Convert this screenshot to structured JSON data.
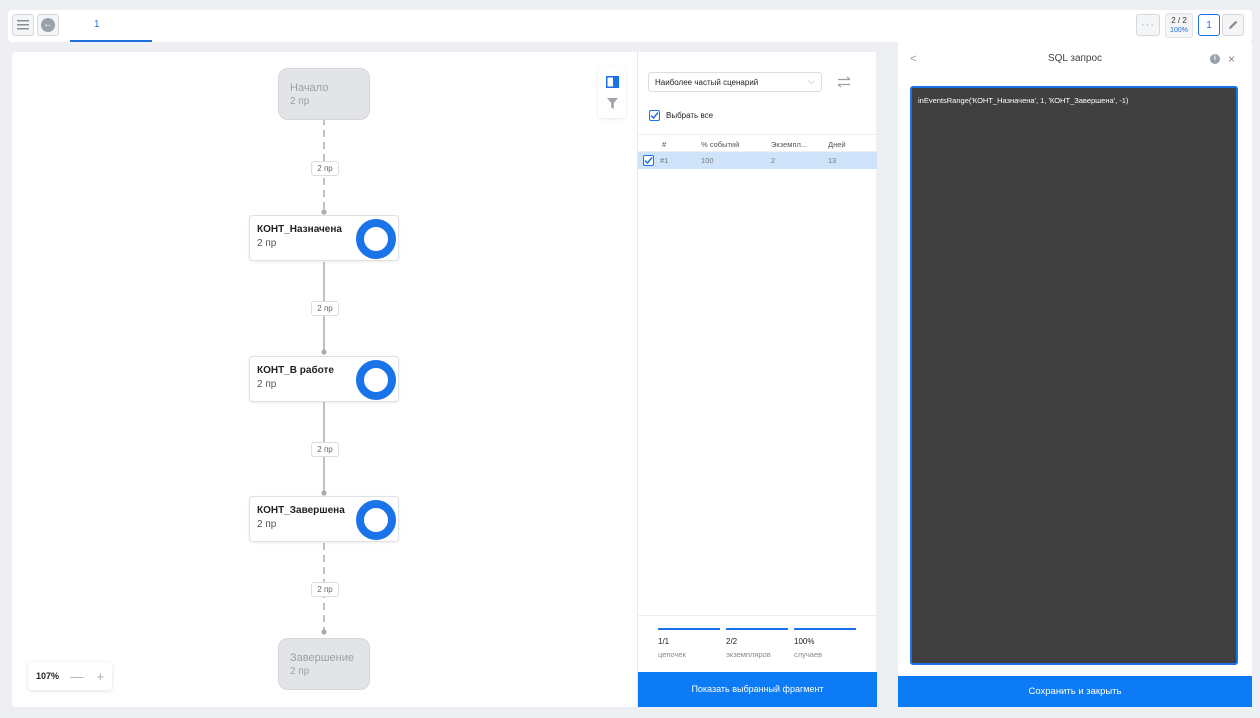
{
  "topbar": {
    "tab_label": "1",
    "more_label": "···",
    "count": "2 / 2",
    "count_pct": "100%",
    "page_number": "1"
  },
  "flow": {
    "start": {
      "title": "Начало",
      "count": "2 пр"
    },
    "end": {
      "title": "Завершение",
      "count": "2 пр"
    },
    "nodes": [
      {
        "title": "КОНТ_Назначена",
        "count": "2 пр"
      },
      {
        "title": "КОНТ_В работе",
        "count": "2 пр"
      },
      {
        "title": "КОНТ_Завершена",
        "count": "2 пр"
      }
    ],
    "edges": [
      "2 пр",
      "2 пр",
      "2 пр",
      "2 пр"
    ],
    "zoom": "107%",
    "zoom_out": "—",
    "zoom_in": "+"
  },
  "scenario": {
    "dropdown_value": "Наиболее частый сценарий",
    "select_all_label": "Выбрать все",
    "columns": [
      "#",
      "% событий",
      "Экземпл...",
      "Дней"
    ],
    "rows": [
      {
        "id": "#1",
        "pct": "100",
        "instances": "2",
        "days": "13"
      }
    ],
    "stats": [
      {
        "value": "1/1",
        "label": "цепочек"
      },
      {
        "value": "2/2",
        "label": "экземпляров"
      },
      {
        "value": "100%",
        "label": "случаев"
      }
    ],
    "show_button": "Показать выбранный фрагмент"
  },
  "sql": {
    "title": "SQL запрос",
    "back_label": "<",
    "close_label": "×",
    "info_label": "i",
    "query": "inEventsRange('КОНТ_Назначена', 1, 'КОНТ_Завершена', -1)",
    "save_button": "Сохранить и закрыть"
  },
  "colors": {
    "accent": "#1a73e8",
    "button": "#0c7bf5",
    "selected_row": "#cfe3fb",
    "editor_bg": "#404040"
  }
}
